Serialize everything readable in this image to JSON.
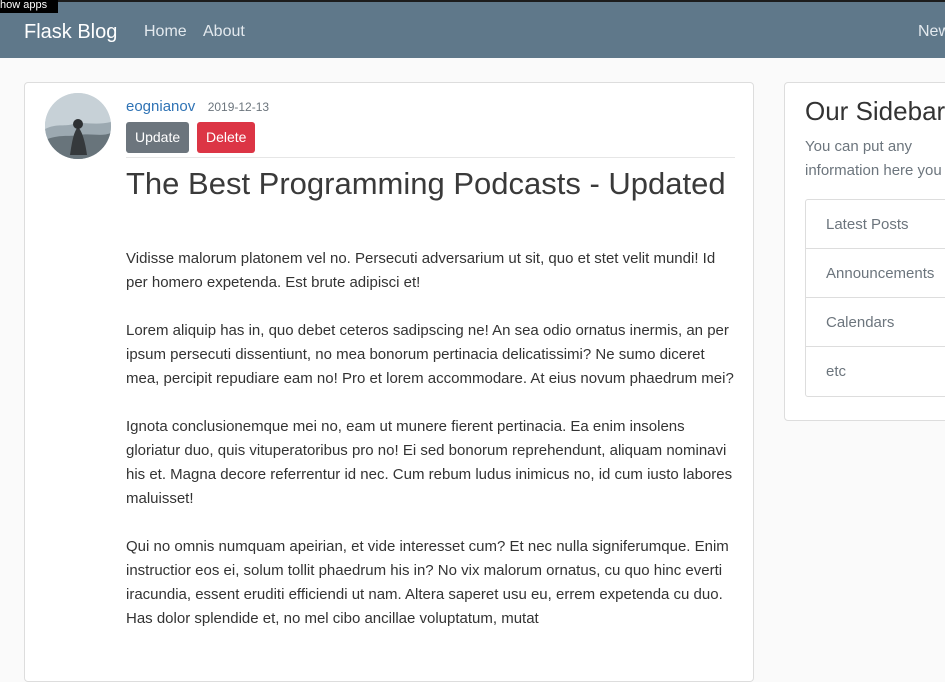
{
  "overlay": {
    "show_apps": "how apps"
  },
  "navbar": {
    "brand": "Flask Blog",
    "links": [
      {
        "label": "Home"
      },
      {
        "label": "About"
      },
      {
        "label": "New"
      }
    ]
  },
  "post": {
    "author": "eognianov",
    "date": "2019-12-13",
    "update_label": "Update",
    "delete_label": "Delete",
    "title": "The Best Programming Podcasts - Updated",
    "paragraphs": [
      "Vidisse malorum platonem vel no. Persecuti adversarium ut sit, quo et stet velit mundi! Id per homero expetenda. Est brute adipisci et!",
      "Lorem aliquip has in, quo debet ceteros sadipscing ne! An sea odio ornatus inermis, an per ipsum persecuti dissentiunt, no mea bonorum pertinacia delicatissimi? Ne sumo diceret mea, percipit repudiare eam no! Pro et lorem accommodare. At eius novum phaedrum mei?",
      "Ignota conclusionemque mei no, eam ut munere fierent pertinacia. Ea enim insolens gloriatur duo, quis vituperatoribus pro no! Ei sed bonorum reprehendunt, aliquam nominavi his et. Magna decore referrentur id nec. Cum rebum ludus inimicus no, id cum iusto labores maluisset!",
      "Qui no omnis numquam apeirian, et vide interesset cum? Et nec nulla signiferumque. Enim instructior eos ei, solum tollit phaedrum his in? No vix malorum ornatus, cu quo hinc everti iracundia, essent eruditi efficiendi ut nam. Altera saperet usu eu, errem expetenda cu duo. Has dolor splendide et, no mel cibo ancillae voluptatum, mutat"
    ]
  },
  "sidebar": {
    "title": "Our Sidebar",
    "text": "You can put any information here you like.",
    "items": [
      {
        "label": "Latest Posts"
      },
      {
        "label": "Announcements"
      },
      {
        "label": "Calendars"
      },
      {
        "label": "etc"
      }
    ]
  },
  "colors": {
    "navbar": "#5f788a",
    "link": "#2f73b5",
    "update_button": "#6c757d",
    "delete_button": "#dc3545"
  }
}
